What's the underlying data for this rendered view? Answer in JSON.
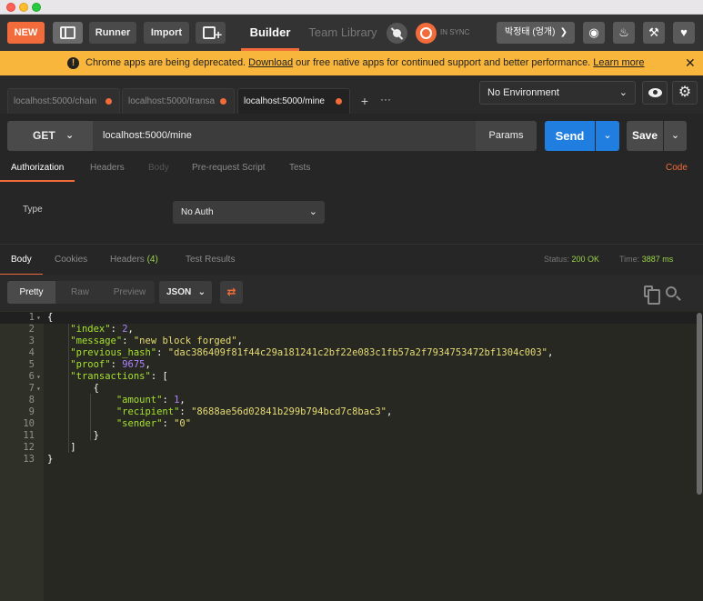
{
  "toolbar": {
    "new_label": "NEW",
    "runner_label": "Runner",
    "import_label": "Import",
    "builder_label": "Builder",
    "team_library_label": "Team Library",
    "sync_status": "IN SYNC",
    "user_name": "박정태 (엉개)"
  },
  "banner": {
    "text_before": "Chrome apps are being deprecated. ",
    "download_link": "Download",
    "text_after": " our free native apps for continued support and better performance. ",
    "learn_more_link": "Learn more",
    "close": "✕"
  },
  "tabs": [
    {
      "label": "localhost:5000/chain"
    },
    {
      "label": "localhost:5000/transa"
    },
    {
      "label": "localhost:5000/mine"
    }
  ],
  "environment": {
    "selected": "No Environment"
  },
  "request": {
    "method": "GET",
    "url": "localhost:5000/mine",
    "params_label": "Params",
    "send_label": "Send",
    "save_label": "Save",
    "tabs": [
      "Authorization",
      "Headers",
      "Body",
      "Pre-request Script",
      "Tests"
    ],
    "code_label": "Code",
    "auth_type_label": "Type",
    "auth_type_value": "No Auth"
  },
  "response": {
    "tabs": [
      "Body",
      "Cookies",
      "Headers",
      "Test Results"
    ],
    "headers_count": "(4)",
    "status_label": "Status:",
    "status_value": "200 OK",
    "time_label": "Time:",
    "time_value": "3887 ms",
    "view_modes": [
      "Pretty",
      "Raw",
      "Preview"
    ],
    "format": "JSON",
    "body": {
      "index": "2",
      "message": "\"new block forged\"",
      "previous_hash": "\"dac386409f81f44c29a181241c2bf22e083c1fb57a2f7934753472bf1304c003\"",
      "proof": "9675",
      "amount": "1",
      "recipient": "\"8688ae56d02841b299b794bcd7c8bac3\"",
      "sender": "\"0\""
    }
  },
  "colors": {
    "accent": "#f26b3a",
    "send": "#1f7ee0",
    "banner": "#f9b63c",
    "success": "#9bd34a"
  }
}
